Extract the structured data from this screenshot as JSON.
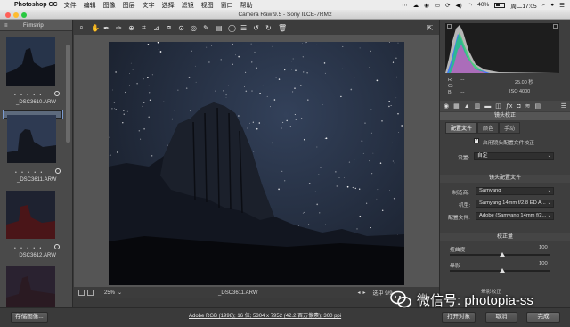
{
  "menubar": {
    "app_name": "Photoshop CC",
    "items": [
      "文件",
      "编辑",
      "图像",
      "图层",
      "文字",
      "选择",
      "滤镜",
      "视图",
      "窗口",
      "帮助"
    ],
    "battery": "40%",
    "clock": "周二17:05"
  },
  "window": {
    "title": "Camera Raw 9.5  -  Sony ILCE-7RM2"
  },
  "filmstrip": {
    "title": "Filmstrip",
    "stars": "• • • • •",
    "thumbs": [
      {
        "name": "_DSC3610.ARW"
      },
      {
        "name": "_DSC3611.ARW"
      },
      {
        "name": "_DSC3612.ARW"
      }
    ]
  },
  "canvas": {
    "zoom": "25%",
    "filename": "_DSC3611.ARW",
    "selection": "选中 9/9"
  },
  "right_panel": {
    "rgb": {
      "r": "R:",
      "g": "G:",
      "b": "B:",
      "dash": "---"
    },
    "exposure": "25.00 秒",
    "iso": "ISO 4000",
    "section_title": "镜头校正",
    "subtabs": [
      "配置文件",
      "颜色",
      "手动"
    ],
    "enable_profile_label": "启用镜头配置文件校正",
    "setup_label": "设置:",
    "setup_value": "自定",
    "profile_section": "镜头配置文件",
    "make_label": "制造商:",
    "make_value": "Samyang",
    "model_label": "机型:",
    "model_value": "Samyang 14mm f/2.8 ED A...",
    "profile_label": "配置文件:",
    "profile_value": "Adobe (Samyang 14mm f/2...",
    "correction_section": "校正量",
    "distortion_label": "扭曲度",
    "distortion_value": "100",
    "vignette_label": "晕影",
    "vignette_value": "100",
    "partial_label": "晕影校正"
  },
  "bottom": {
    "save_label": "存储图像...",
    "workflow_link": "Adobe RGB (1998); 16 位; 5304 x 7952 (42.2 百万像素); 300 ppi",
    "open_label": "打开对象",
    "cancel_label": "取消",
    "done_label": "完成"
  },
  "watermark": {
    "text": "微信号: photopia-ss"
  }
}
